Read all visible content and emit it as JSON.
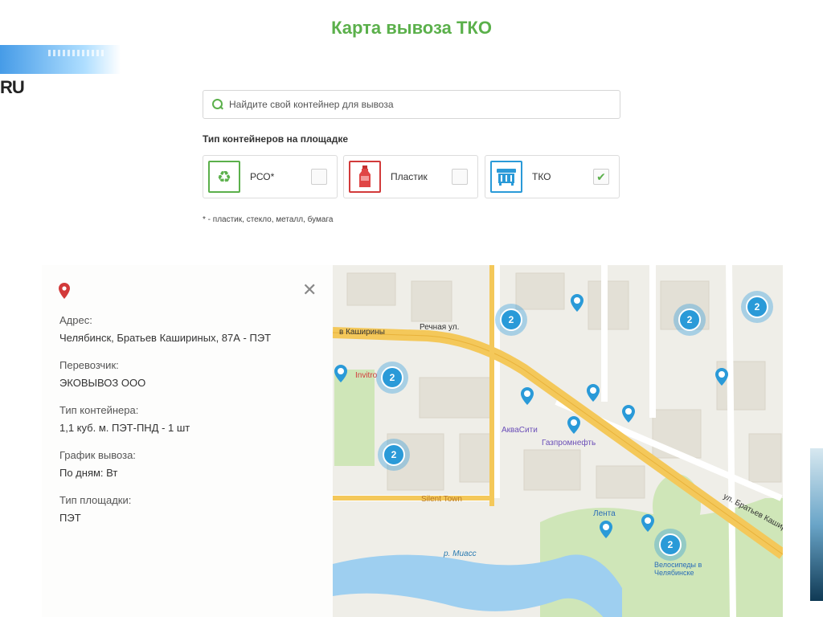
{
  "page": {
    "title": "Карта вывоза ТКО",
    "channel_logo_text": "RU"
  },
  "search": {
    "placeholder": "Найдите свой контейнер для вывоза"
  },
  "container_types": {
    "label": "Тип контейнеров на площадке",
    "items": [
      {
        "label": "РСО*",
        "icon": "recycle-icon",
        "color": "#5bb04b",
        "checked": false
      },
      {
        "label": "Пластик",
        "icon": "bottle-icon",
        "color": "#d23a3a",
        "checked": false
      },
      {
        "label": "ТКО",
        "icon": "dumpster-icon",
        "color": "#2a9ad8",
        "checked": true
      }
    ],
    "footnote": "* - пластик, стекло, металл, бумага"
  },
  "info_card": {
    "address_label": "Адрес:",
    "address_value": "Челябинск, Братьев Кашириных, 87А - ПЭТ",
    "carrier_label": "Перевозчик:",
    "carrier_value": "ЭКОВЫВОЗ ООО",
    "container_label": "Тип контейнера:",
    "container_value": "1,1 куб. м. ПЭТ-ПНД - 1 шт",
    "schedule_label": "График вывоза:",
    "schedule_value": "По дням: Вт",
    "site_label": "Тип площадки:",
    "site_value": "ПЭТ",
    "close_glyph": "✕"
  },
  "map": {
    "clusters": [
      "2",
      "2",
      "2",
      "2",
      "2",
      "2"
    ],
    "labels": {
      "street_main": "ул. Братьев Кашириных",
      "street_main_top": "в Каширины",
      "invitro": "Invitro",
      "akvasiti": "АкваСити",
      "gazpromneft": "Газпромнефть",
      "silent_town": "Silent Town",
      "lenta": "Лента",
      "velo": "Велосипеды в Челябинске",
      "river": "р. Миасс",
      "street_side": "Речная ул."
    },
    "colors": {
      "road": "#f4c85a",
      "water": "#9ecff0",
      "park": "#cfe6b8",
      "building": "#e3e0d6",
      "cluster": "#2a9ad8"
    }
  }
}
